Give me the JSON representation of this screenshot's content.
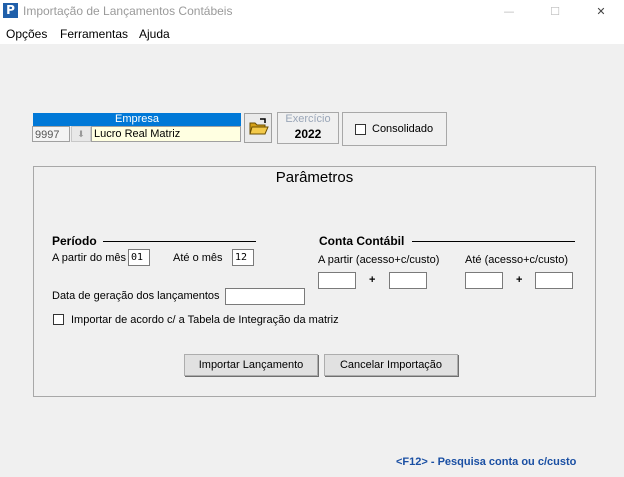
{
  "window": {
    "title": "Importação de Lançamentos Contábeis",
    "app_icon": "P",
    "minimize_glyph": "—",
    "maximize_glyph": "☐",
    "close_glyph": "✕"
  },
  "menu": {
    "items": [
      {
        "label": "Opções"
      },
      {
        "label": "Ferramentas"
      },
      {
        "label": "Ajuda"
      }
    ]
  },
  "empresa": {
    "header": "Empresa",
    "code": "9997",
    "name": "Lucro Real Matriz",
    "folder_icon": "open-folder-icon"
  },
  "exercicio": {
    "label": "Exercício",
    "value": "2022"
  },
  "consolidado": {
    "label": "Consolidado",
    "checked": false
  },
  "parametros": {
    "title": "Parâmetros",
    "periodo": {
      "title": "Período",
      "from_label": "A partir do mês",
      "from_value": "01",
      "to_label": "Até o mês",
      "to_value": "12",
      "data_geracao_label": "Data de geração dos lançamentos",
      "data_geracao_value": ""
    },
    "conta": {
      "title": "Conta Contábil",
      "from_label": "A partir (acesso+c/custo)",
      "to_label": "Até (acesso+c/custo)",
      "plus": "+"
    },
    "importar_tabela_label": "Importar de acordo c/ a Tabela de Integração da matriz",
    "importar_tabela_checked": false
  },
  "buttons": {
    "importar": "Importar Lançamento",
    "cancelar": "Cancelar Importação"
  },
  "hint": {
    "f12": "<F12>  - Pesquisa conta ou c/custo"
  },
  "colors": {
    "accent": "#0078d7",
    "hint": "#1a4fa3",
    "name_field_bg": "#ffffe1"
  }
}
